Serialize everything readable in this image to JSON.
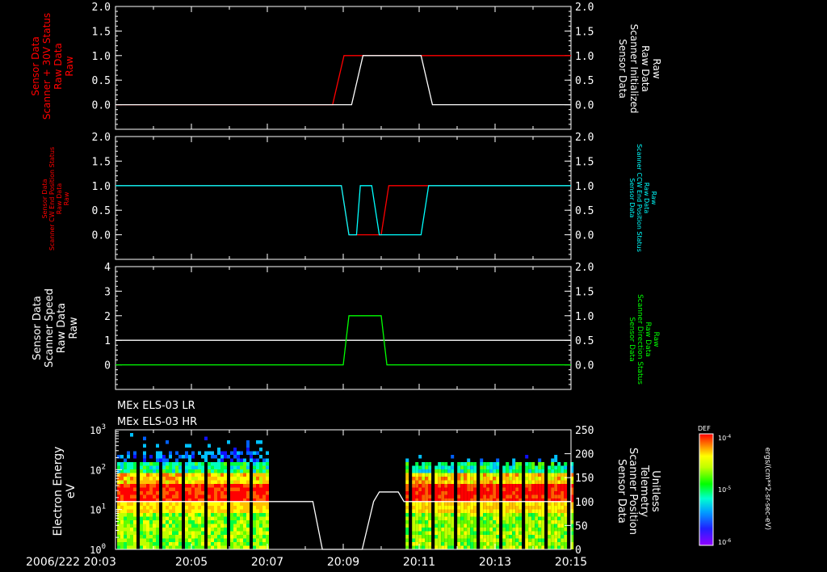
{
  "colors": {
    "axis": "#ffffff",
    "red": "#ff0000",
    "cyan": "#00ffff",
    "green": "#00ff00",
    "white": "#ffffff"
  },
  "time_axis": {
    "start_label": "2006/222 20:03",
    "ticks": [
      "20:05",
      "20:07",
      "20:09",
      "20:11",
      "20:13",
      "20:15"
    ],
    "start_min": 0,
    "end_min": 12
  },
  "panels": {
    "p1": {
      "left_title": [
        "Sensor Data",
        "Scanner + 30V Status",
        "Raw Data",
        "Raw"
      ],
      "right_title": [
        "Sensor Data",
        "Scanner Initialized",
        "Raw Data",
        "Raw"
      ],
      "left_ticks": [
        "0.0",
        "0.5",
        "1.0",
        "1.5",
        "2.0"
      ],
      "right_ticks": [
        "0.0",
        "0.5",
        "1.0",
        "1.5",
        "2.0"
      ]
    },
    "p2": {
      "left_title": [
        "Sensor Data",
        "Scanner CW End Position Status",
        "Raw Data",
        "Raw"
      ],
      "right_title": [
        "Sensor Data",
        "Scanner CCW End Position Status",
        "Raw Data",
        "Raw"
      ],
      "left_ticks": [
        "0.0",
        "0.5",
        "1.0",
        "1.5",
        "2.0"
      ],
      "right_ticks": [
        "0.0",
        "0.5",
        "1.0",
        "1.5",
        "2.0"
      ]
    },
    "p3": {
      "left_title": [
        "Sensor Data",
        "Scanner Speed",
        "Raw Data",
        "Raw"
      ],
      "right_title": [
        "Sensor Data",
        "Scanner Direction Status",
        "Raw Data",
        "Raw"
      ],
      "left_ticks": [
        "0",
        "1",
        "2",
        "3",
        "4"
      ],
      "right_ticks": [
        "0.0",
        "0.5",
        "1.0",
        "1.5",
        "2.0"
      ]
    },
    "p4": {
      "header_lines": [
        "MEx ELS-03 LR",
        "MEx ELS-03 HR"
      ],
      "left_title": [
        "Electron Energy",
        "eV"
      ],
      "right_title": [
        "Sensor Data",
        "Scanner Position",
        "Telemetry",
        "Unitless"
      ],
      "left_ticks": [
        "10",
        "10",
        "10",
        "10"
      ],
      "left_tick_exponents": [
        "0",
        "1",
        "2",
        "3"
      ],
      "right_ticks": [
        "0",
        "50",
        "100",
        "150",
        "200",
        "250"
      ]
    }
  },
  "colorbar": {
    "title": "DEF",
    "labels": [
      "10",
      "10",
      "10"
    ],
    "label_exponents": [
      "-4",
      "-5",
      "-6"
    ],
    "units": "ergs/(cm**2-sr-sec-eV)"
  },
  "chart_data": [
    {
      "type": "line",
      "panel": "p1",
      "ylim": [
        -0.5,
        2.0
      ],
      "series": [
        {
          "color": "red",
          "x": [
            0,
            5.72,
            6.02,
            6.3,
            12
          ],
          "y": [
            0,
            0,
            1,
            1,
            1
          ]
        },
        {
          "color": "white",
          "x": [
            0,
            6.22,
            6.52,
            8.05,
            8.35,
            12
          ],
          "y": [
            0,
            0,
            1,
            1,
            0,
            0
          ]
        }
      ]
    },
    {
      "type": "line",
      "panel": "p2",
      "ylim": [
        -0.5,
        2.0
      ],
      "series": [
        {
          "color": "red",
          "x": [
            0,
            5.95,
            6.15,
            6.55,
            6.75,
            7.0,
            7.2,
            12
          ],
          "y": [
            1,
            1,
            0,
            0,
            0,
            0,
            1,
            1
          ]
        },
        {
          "color": "cyan",
          "x": [
            0,
            5.95,
            6.15,
            6.35,
            6.45,
            6.55,
            6.65,
            6.75,
            6.95,
            8.05,
            8.25,
            12
          ],
          "y": [
            1,
            1,
            0,
            0,
            1,
            1,
            1,
            1,
            0,
            0,
            1,
            1
          ]
        }
      ]
    },
    {
      "type": "line",
      "panel": "p3",
      "ylim": [
        -1.0,
        4.0
      ],
      "series": [
        {
          "color": "white",
          "x": [
            0,
            12
          ],
          "y": [
            1,
            1
          ]
        },
        {
          "color": "green",
          "x": [
            0,
            6.0,
            6.15,
            7.0,
            7.15,
            12
          ],
          "y": [
            0,
            0,
            2,
            2,
            0,
            0
          ]
        }
      ]
    },
    {
      "type": "heatmap",
      "panel": "p4",
      "energy_range_eV": [
        1,
        1000
      ],
      "data_intervals_min": [
        [
          0,
          4.0
        ],
        [
          7.6,
          12
        ]
      ],
      "scanner_position": {
        "x": [
          0,
          5.2,
          5.45,
          6.5,
          6.8,
          6.95,
          7.45,
          7.6,
          12
        ],
        "y": [
          100,
          100,
          0,
          0,
          100,
          120,
          120,
          100,
          100
        ]
      }
    }
  ]
}
